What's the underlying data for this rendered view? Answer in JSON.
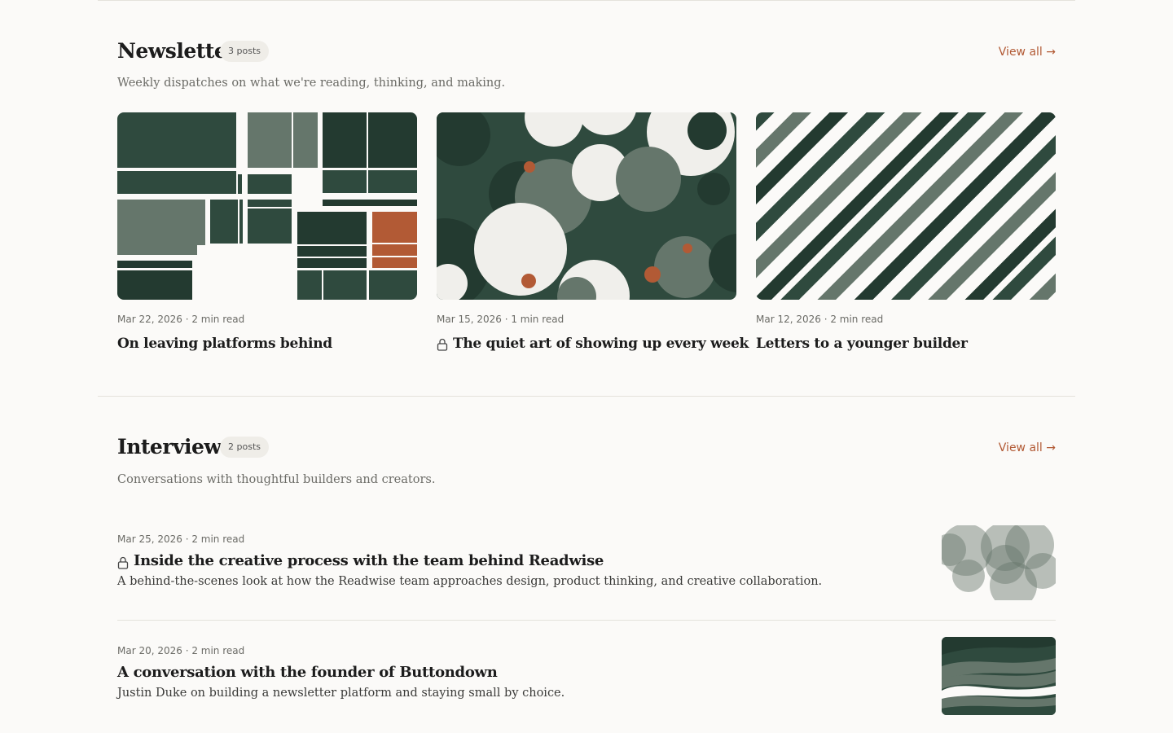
{
  "colors": {
    "accent": "#b25a35",
    "dark_green": "#2f4a3e",
    "darker_green": "#233a30",
    "sage": "#65766b",
    "paper": "#fbfaf8"
  },
  "newsletter": {
    "title": "Newsletter",
    "badge": "3 posts",
    "view_all": "View all →",
    "description": "Weekly dispatches on what we're reading, thinking, and making.",
    "posts": [
      {
        "meta": "Mar 22, 2026 · 2 min read",
        "title": "On leaving platforms behind",
        "locked": false
      },
      {
        "meta": "Mar 15, 2026 · 1 min read",
        "title": "The quiet art of showing up every week",
        "locked": true
      },
      {
        "meta": "Mar 12, 2026 · 2 min read",
        "title": "Letters to a younger builder",
        "locked": false
      }
    ]
  },
  "interviews": {
    "title": "Interviews",
    "badge": "2 posts",
    "view_all": "View all →",
    "description": "Conversations with thoughtful builders and creators.",
    "posts": [
      {
        "meta": "Mar 25, 2026 · 2 min read",
        "title": "Inside the creative process with the team behind Readwise",
        "description": "A behind-the-scenes look at how the Readwise team approaches design, product thinking, and creative collaboration.",
        "locked": true
      },
      {
        "meta": "Mar 20, 2026 · 2 min read",
        "title": "A conversation with the founder of Buttondown",
        "description": "Justin Duke on building a newsletter platform and staying small by choice.",
        "locked": false
      }
    ]
  }
}
